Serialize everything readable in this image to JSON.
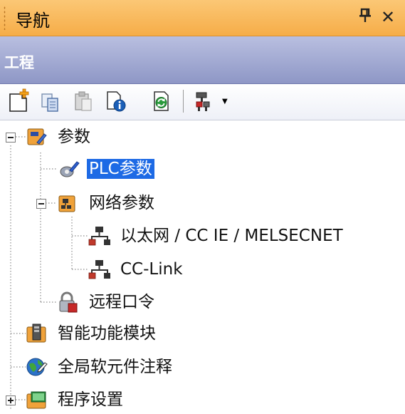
{
  "panel": {
    "title": "导航",
    "pin_label": "ᵽ",
    "close_label": "✕"
  },
  "section": {
    "title": "工程"
  },
  "toolbar": {
    "buttons": [
      {
        "icon": "new-data-icon"
      },
      {
        "icon": "copy-icon"
      },
      {
        "icon": "paste-icon"
      },
      {
        "icon": "properties-icon"
      },
      {
        "icon": "refresh-icon"
      },
      {
        "icon": "display-options-icon"
      }
    ]
  },
  "tree": {
    "items": [
      {
        "label": "参数",
        "expanded": true
      },
      {
        "label": "PLC参数",
        "selected": true
      },
      {
        "label": "网络参数",
        "expanded": true
      },
      {
        "label": "以太网 / CC IE / MELSECNET"
      },
      {
        "label": "CC-Link"
      },
      {
        "label": "远程口令"
      },
      {
        "label": "智能功能模块"
      },
      {
        "label": "全局软元件注释"
      },
      {
        "label": "程序设置",
        "expanded": false
      }
    ]
  },
  "colors": {
    "title_bar": "#f6ad48",
    "section_header": "#8e97c6",
    "selection": "#1d6ae5"
  }
}
